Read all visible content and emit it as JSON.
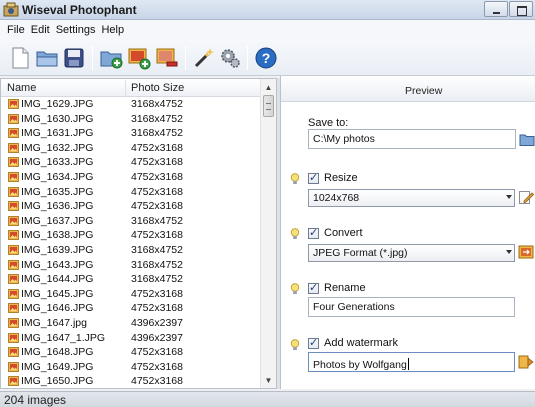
{
  "window": {
    "title": "Wiseval Photophant"
  },
  "menu": [
    "File",
    "Edit",
    "Settings",
    "Help"
  ],
  "toolbar": {
    "icons": [
      "new-icon",
      "open-folder-icon",
      "save-icon",
      "add-folder-icon",
      "add-images-icon",
      "remove-images-icon",
      "magic-wand-icon",
      "settings-gears-icon",
      "help-icon"
    ]
  },
  "file_list": {
    "columns": {
      "name": "Name",
      "size": "Photo Size"
    },
    "rows": [
      {
        "name": "IMG_1629.JPG",
        "size": "3168x4752"
      },
      {
        "name": "IMG_1630.JPG",
        "size": "3168x4752"
      },
      {
        "name": "IMG_1631.JPG",
        "size": "3168x4752"
      },
      {
        "name": "IMG_1632.JPG",
        "size": "4752x3168"
      },
      {
        "name": "IMG_1633.JPG",
        "size": "4752x3168"
      },
      {
        "name": "IMG_1634.JPG",
        "size": "4752x3168"
      },
      {
        "name": "IMG_1635.JPG",
        "size": "4752x3168"
      },
      {
        "name": "IMG_1636.JPG",
        "size": "4752x3168"
      },
      {
        "name": "IMG_1637.JPG",
        "size": "3168x4752"
      },
      {
        "name": "IMG_1638.JPG",
        "size": "4752x3168"
      },
      {
        "name": "IMG_1639.JPG",
        "size": "3168x4752"
      },
      {
        "name": "IMG_1643.JPG",
        "size": "3168x4752"
      },
      {
        "name": "IMG_1644.JPG",
        "size": "3168x4752"
      },
      {
        "name": "IMG_1645.JPG",
        "size": "4752x3168"
      },
      {
        "name": "IMG_1646.JPG",
        "size": "4752x3168"
      },
      {
        "name": "IMG_1647.jpg",
        "size": "4396x2397"
      },
      {
        "name": "IMG_1647_1.JPG",
        "size": "4396x2397"
      },
      {
        "name": "IMG_1648.JPG",
        "size": "4752x3168"
      },
      {
        "name": "IMG_1649.JPG",
        "size": "4752x3168"
      },
      {
        "name": "IMG_1650.JPG",
        "size": "4752x3168"
      }
    ]
  },
  "preview": {
    "header": "Preview",
    "save_to": {
      "label": "Save to:",
      "value": "C:\\My photos"
    },
    "resize": {
      "label": "Resize",
      "checked": true,
      "value": "1024x768"
    },
    "convert": {
      "label": "Convert",
      "checked": true,
      "value": "JPEG Format (*.jpg)"
    },
    "rename": {
      "label": "Rename",
      "checked": true,
      "value": "Four Generations"
    },
    "watermark": {
      "label": "Add watermark",
      "checked": true,
      "value": "Photos by Wolfgang"
    }
  },
  "status": {
    "text": "204 images"
  },
  "colors": {
    "accent": "#2b6cc4",
    "folder": "#f2c14e",
    "list_bg": "#ffffff"
  }
}
